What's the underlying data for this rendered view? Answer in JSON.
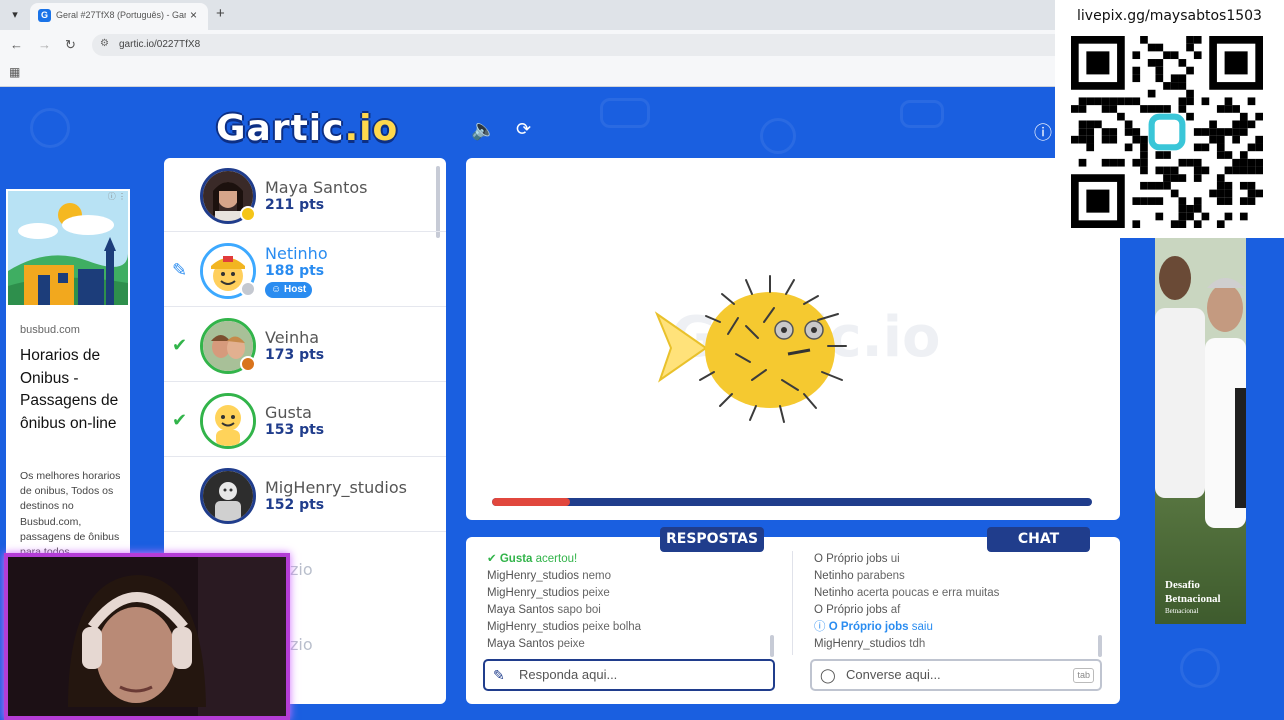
{
  "browser": {
    "tab_title": "Geral #27TfX8 (Português) - Gar",
    "url": "gartic.io/0227TfX8"
  },
  "header": {
    "logo_main": "Gartic",
    "logo_suffix": ".io"
  },
  "ad_left": {
    "domain": "busbud.com",
    "title": "Horarios de Onibus - Passagens de ônibus on-line",
    "description": "Os melhores horarios de onibus, Todos os destinos no Busbud.com, passagens de ônibus para todos"
  },
  "players": [
    {
      "name": "Maya Santos",
      "points": "211 pts",
      "status_color": "#f5c518"
    },
    {
      "name": "Netinho",
      "points": "188 pts",
      "status_color": "#c4c8d0",
      "host_label": "Host",
      "drawing": true
    },
    {
      "name": "Veinha",
      "points": "173 pts",
      "status_color": "#d9731c",
      "guessed": true
    },
    {
      "name": "Gusta",
      "points": "153 pts",
      "guessed": true
    },
    {
      "name": "MigHenry_studios",
      "points": "152 pts"
    }
  ],
  "faded_players": [
    "zio",
    "zio"
  ],
  "timer": {
    "remaining_fraction": 0.13
  },
  "answers": {
    "label": "RESPOSTAS",
    "messages": [
      {
        "user": "Gusta",
        "text": "acertou!",
        "type": "ok"
      },
      {
        "user": "MigHenry_studios",
        "text": "nemo"
      },
      {
        "user": "MigHenry_studios",
        "text": "peixe"
      },
      {
        "user": "Maya Santos",
        "text": "sapo boi"
      },
      {
        "user": "MigHenry_studios",
        "text": "peixe bolha"
      },
      {
        "user": "Maya Santos",
        "text": "peixe"
      }
    ],
    "placeholder": "Responda aqui..."
  },
  "chat": {
    "label": "CHAT",
    "messages": [
      {
        "user": "O Próprio jobs",
        "text": "ui"
      },
      {
        "user": "Netinho",
        "text": "parabens"
      },
      {
        "user": "Netinho",
        "text": "acerta poucas e erra muitas"
      },
      {
        "user": "O Próprio jobs",
        "text": "af"
      },
      {
        "user": "O Próprio jobs",
        "text": "saiu",
        "type": "info"
      },
      {
        "user": "MigHenry_studios",
        "text": "tdh"
      }
    ],
    "placeholder": "Converse aqui...",
    "tab_hint": "tab"
  },
  "ad_right": {
    "title": "Desafio Betnacional",
    "subtitle": "Betnacional"
  },
  "overlay": {
    "qr_url": "livepix.gg/maysabtos1503"
  },
  "colors": {
    "brand_blue": "#1a5fe0",
    "navy": "#203d8c",
    "accent": "#2a8cf0",
    "success": "#32b44a",
    "timer": "#e1473d"
  }
}
